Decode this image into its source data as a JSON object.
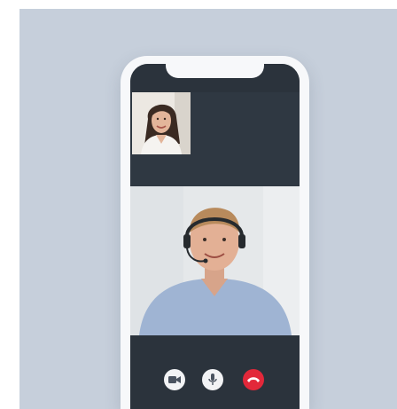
{
  "call": {
    "remote_participant": "man-with-headset",
    "local_participant": "woman-smiling",
    "controls": [
      {
        "name": "camera",
        "icon": "video-camera-icon"
      },
      {
        "name": "microphone",
        "icon": "microphone-icon"
      },
      {
        "name": "end-call",
        "icon": "phone-hangup-icon"
      }
    ]
  },
  "colors": {
    "backdrop": "#c6cfdb",
    "phone_frame": "#f7f8fa",
    "screen": "#2b333c",
    "end_call": "#e2283a",
    "control_button": "#f2f3f5"
  }
}
